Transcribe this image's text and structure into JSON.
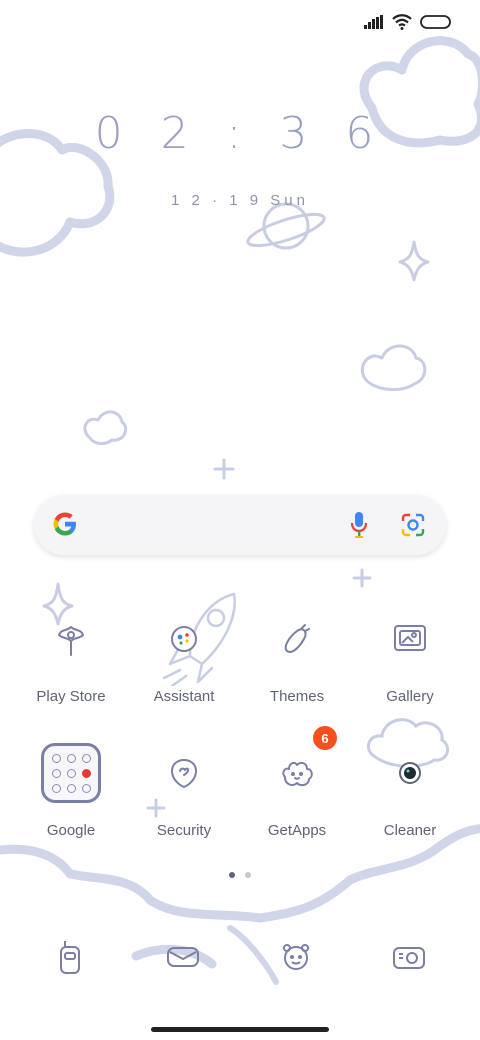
{
  "clock": {
    "time": "0 2 : 3 6",
    "date": "1 2 · 1 9  Sun"
  },
  "search": {
    "placeholder": ""
  },
  "apps": [
    {
      "label": "Play Store"
    },
    {
      "label": "Assistant"
    },
    {
      "label": "Themes"
    },
    {
      "label": "Gallery"
    },
    {
      "label": "Google"
    },
    {
      "label": "Security"
    },
    {
      "label": "GetApps",
      "badge": "6"
    },
    {
      "label": "Cleaner"
    }
  ],
  "pager": {
    "pages": 2,
    "current": 1
  },
  "dock": [
    "phone-icon",
    "messages-icon",
    "browser-icon",
    "camera-icon"
  ],
  "colors": {
    "accent": "#9aa0c2",
    "badge": "#f4511e",
    "cloud": "#d4d7ea"
  }
}
